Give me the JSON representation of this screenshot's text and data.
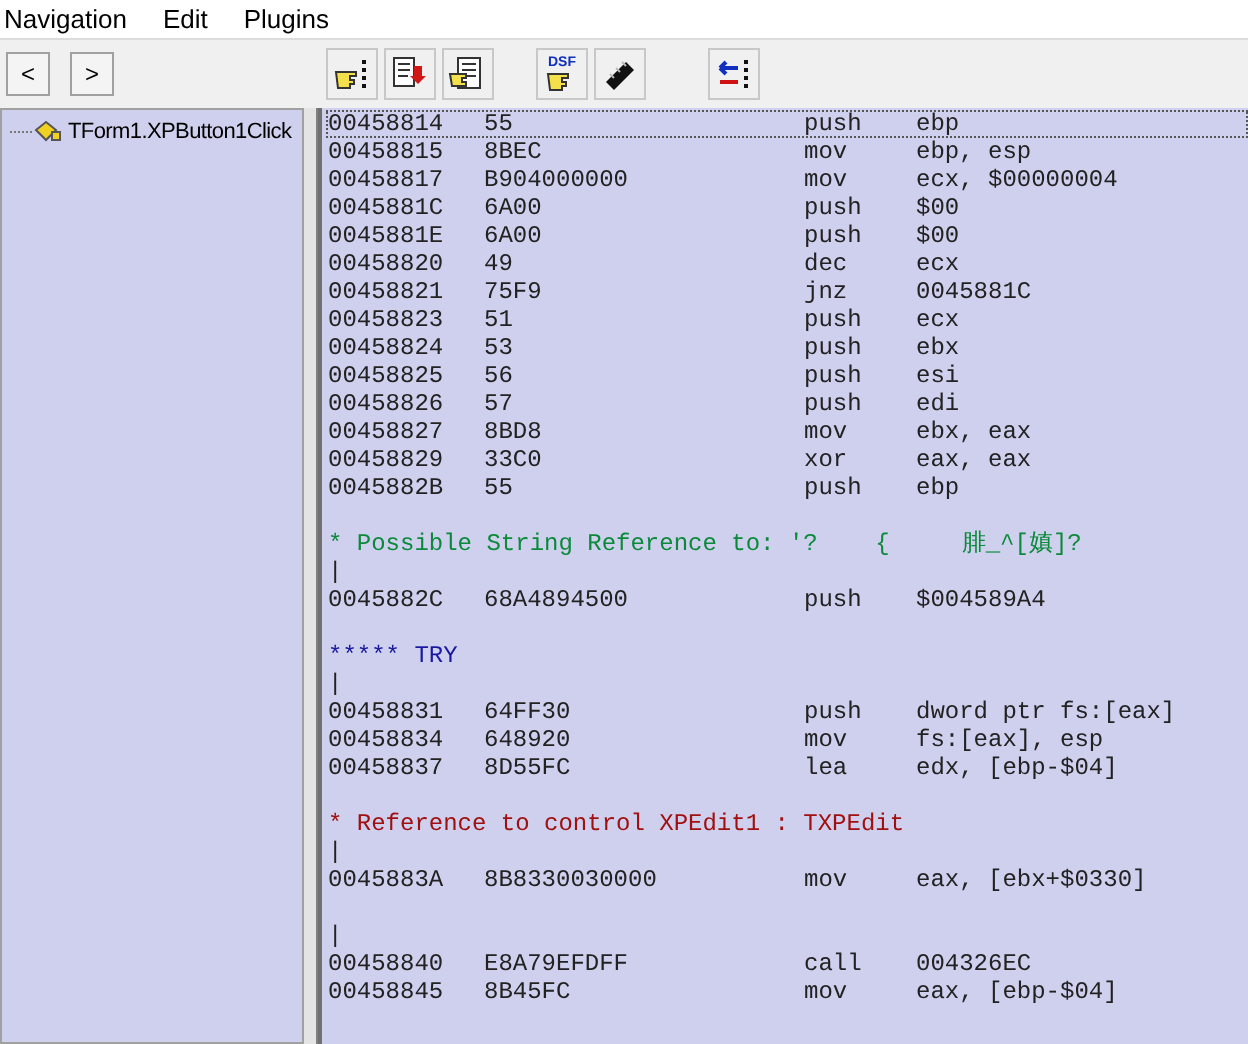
{
  "menu": [
    "Navigation",
    "Edit",
    "Plugins"
  ],
  "nav_buttons": [
    "<",
    ">"
  ],
  "toolbar": [
    {
      "kind": "hand-list"
    },
    {
      "kind": "doc-red"
    },
    {
      "kind": "doc-hand"
    },
    {
      "kind": "dsf",
      "label": "DSF"
    },
    {
      "kind": "chip"
    },
    {
      "kind": "arrows"
    }
  ],
  "tree": [
    {
      "label": "TForm1.XPButton1Click",
      "selected": false
    }
  ],
  "listing": [
    {
      "kind": "code",
      "address": "00458814",
      "bytes": "55",
      "mnemonic": "push",
      "operand": "ebp",
      "selected": true
    },
    {
      "kind": "code",
      "address": "00458815",
      "bytes": "8BEC",
      "mnemonic": "mov",
      "operand": "ebp, esp",
      "selected": false
    },
    {
      "kind": "code",
      "address": "00458817",
      "bytes": "B904000000",
      "mnemonic": "mov",
      "operand": "ecx, $00000004",
      "selected": false
    },
    {
      "kind": "code",
      "address": "0045881C",
      "bytes": "6A00",
      "mnemonic": "push",
      "operand": "$00",
      "selected": false
    },
    {
      "kind": "code",
      "address": "0045881E",
      "bytes": "6A00",
      "mnemonic": "push",
      "operand": "$00",
      "selected": false
    },
    {
      "kind": "code",
      "address": "00458820",
      "bytes": "49",
      "mnemonic": "dec",
      "operand": "ecx",
      "selected": false
    },
    {
      "kind": "code",
      "address": "00458821",
      "bytes": "75F9",
      "mnemonic": "jnz",
      "operand": "0045881C",
      "selected": false
    },
    {
      "kind": "code",
      "address": "00458823",
      "bytes": "51",
      "mnemonic": "push",
      "operand": "ecx",
      "selected": false
    },
    {
      "kind": "code",
      "address": "00458824",
      "bytes": "53",
      "mnemonic": "push",
      "operand": "ebx",
      "selected": false
    },
    {
      "kind": "code",
      "address": "00458825",
      "bytes": "56",
      "mnemonic": "push",
      "operand": "esi",
      "selected": false
    },
    {
      "kind": "code",
      "address": "00458826",
      "bytes": "57",
      "mnemonic": "push",
      "operand": "edi",
      "selected": false
    },
    {
      "kind": "code",
      "address": "00458827",
      "bytes": "8BD8",
      "mnemonic": "mov",
      "operand": "ebx, eax",
      "selected": false
    },
    {
      "kind": "code",
      "address": "00458829",
      "bytes": "33C0",
      "mnemonic": "xor",
      "operand": "eax, eax",
      "selected": false
    },
    {
      "kind": "code",
      "address": "0045882B",
      "bytes": "55",
      "mnemonic": "push",
      "operand": "ebp",
      "selected": false
    },
    {
      "kind": "blank",
      "selected": false
    },
    {
      "kind": "comment",
      "text": "* Possible String Reference to: '?    {     腓_^[嫃]?",
      "color": "#0a8a3a",
      "selected": false
    },
    {
      "kind": "bar",
      "text": "|",
      "selected": false
    },
    {
      "kind": "code",
      "address": "0045882C",
      "bytes": "68A4894500",
      "mnemonic": "push",
      "operand": "$004589A4",
      "selected": false
    },
    {
      "kind": "blank",
      "selected": false
    },
    {
      "kind": "comment",
      "text": "***** TRY",
      "color": "#1a1aa0",
      "selected": false
    },
    {
      "kind": "bar",
      "text": "|",
      "selected": false
    },
    {
      "kind": "code",
      "address": "00458831",
      "bytes": "64FF30",
      "mnemonic": "push",
      "operand": "dword ptr fs:[eax]",
      "selected": false
    },
    {
      "kind": "code",
      "address": "00458834",
      "bytes": "648920",
      "mnemonic": "mov",
      "operand": "fs:[eax], esp",
      "selected": false
    },
    {
      "kind": "code",
      "address": "00458837",
      "bytes": "8D55FC",
      "mnemonic": "lea",
      "operand": "edx, [ebp-$04]",
      "selected": false
    },
    {
      "kind": "blank",
      "selected": false
    },
    {
      "kind": "comment",
      "text": "* Reference to control XPEdit1 : TXPEdit",
      "color": "#a01010",
      "selected": false
    },
    {
      "kind": "bar",
      "text": "|",
      "selected": false
    },
    {
      "kind": "code",
      "address": "0045883A",
      "bytes": "8B8330030000",
      "mnemonic": "mov",
      "operand": "eax, [ebx+$0330]",
      "selected": false
    },
    {
      "kind": "blank",
      "selected": false
    },
    {
      "kind": "bar",
      "text": "|",
      "selected": false
    },
    {
      "kind": "code",
      "address": "00458840",
      "bytes": "E8A79EFDFF",
      "mnemonic": "call",
      "operand": "004326EC",
      "selected": false
    },
    {
      "kind": "code",
      "address": "00458845",
      "bytes": "8B45FC",
      "mnemonic": "mov",
      "operand": "eax, [ebp-$04]",
      "selected": false
    }
  ]
}
